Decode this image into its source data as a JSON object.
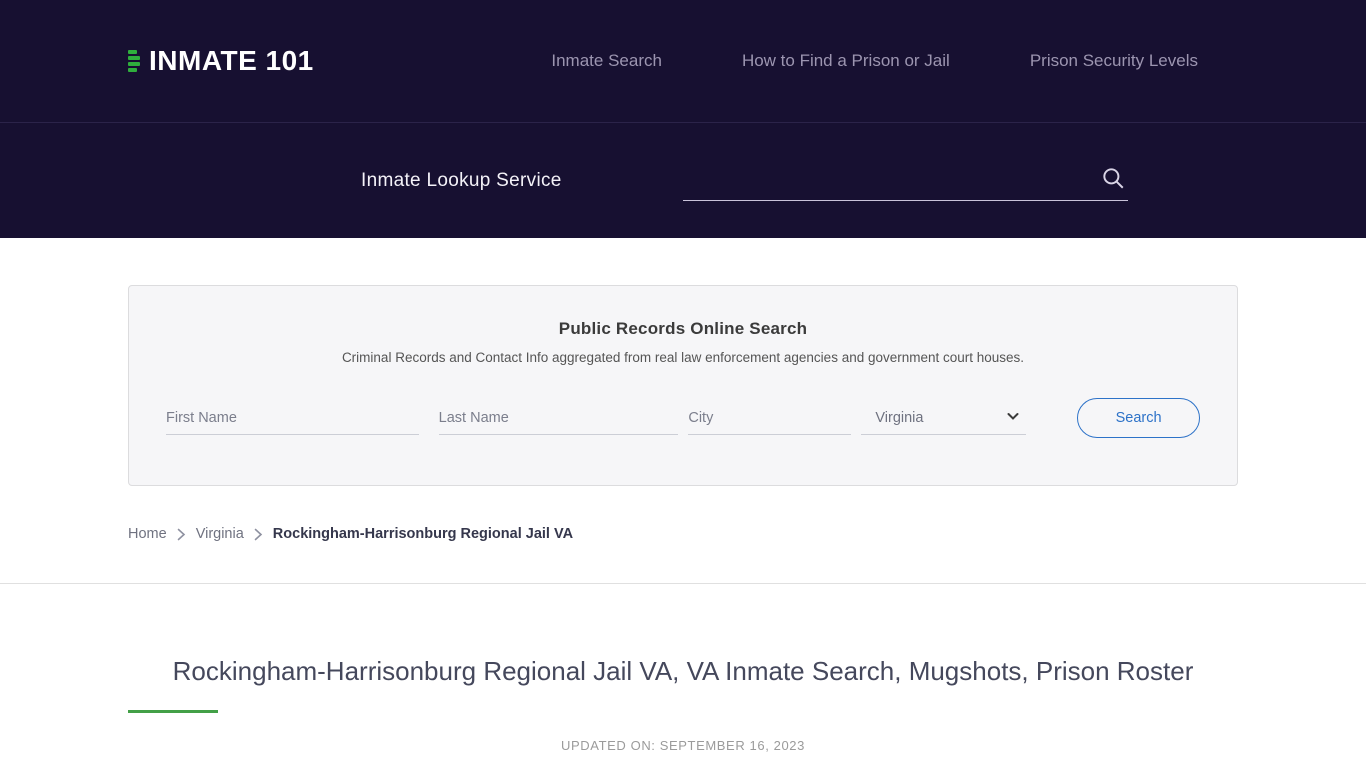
{
  "brand": {
    "name": "INMATE 101",
    "logo_icon": "menu-bars-icon"
  },
  "nav": {
    "items": [
      {
        "label": "Inmate Search"
      },
      {
        "label": "How to Find a Prison or Jail"
      },
      {
        "label": "Prison Security Levels"
      }
    ]
  },
  "subheader": {
    "title": "Inmate Lookup Service",
    "search_value": "",
    "search_icon": "search-icon"
  },
  "search_card": {
    "title": "Public Records Online Search",
    "subtitle": "Criminal Records and Contact Info aggregated from real law enforcement agencies and government court houses.",
    "fields": {
      "first_name_placeholder": "First Name",
      "last_name_placeholder": "Last Name",
      "city_placeholder": "City"
    },
    "state_selected": "Virginia",
    "search_button_label": "Search"
  },
  "breadcrumb": {
    "items": [
      {
        "label": "Home"
      },
      {
        "label": "Virginia"
      },
      {
        "label": "Rockingham-Harrisonburg Regional Jail VA"
      }
    ]
  },
  "page": {
    "title": "Rockingham-Harrisonburg Regional Jail VA, VA Inmate Search, Mugshots, Prison Roster",
    "updated_on": "UPDATED ON: SEPTEMBER 16, 2023"
  },
  "colors": {
    "header_bg": "#171031",
    "accent_green": "#2fae3d",
    "button_blue": "#2d72c8"
  }
}
